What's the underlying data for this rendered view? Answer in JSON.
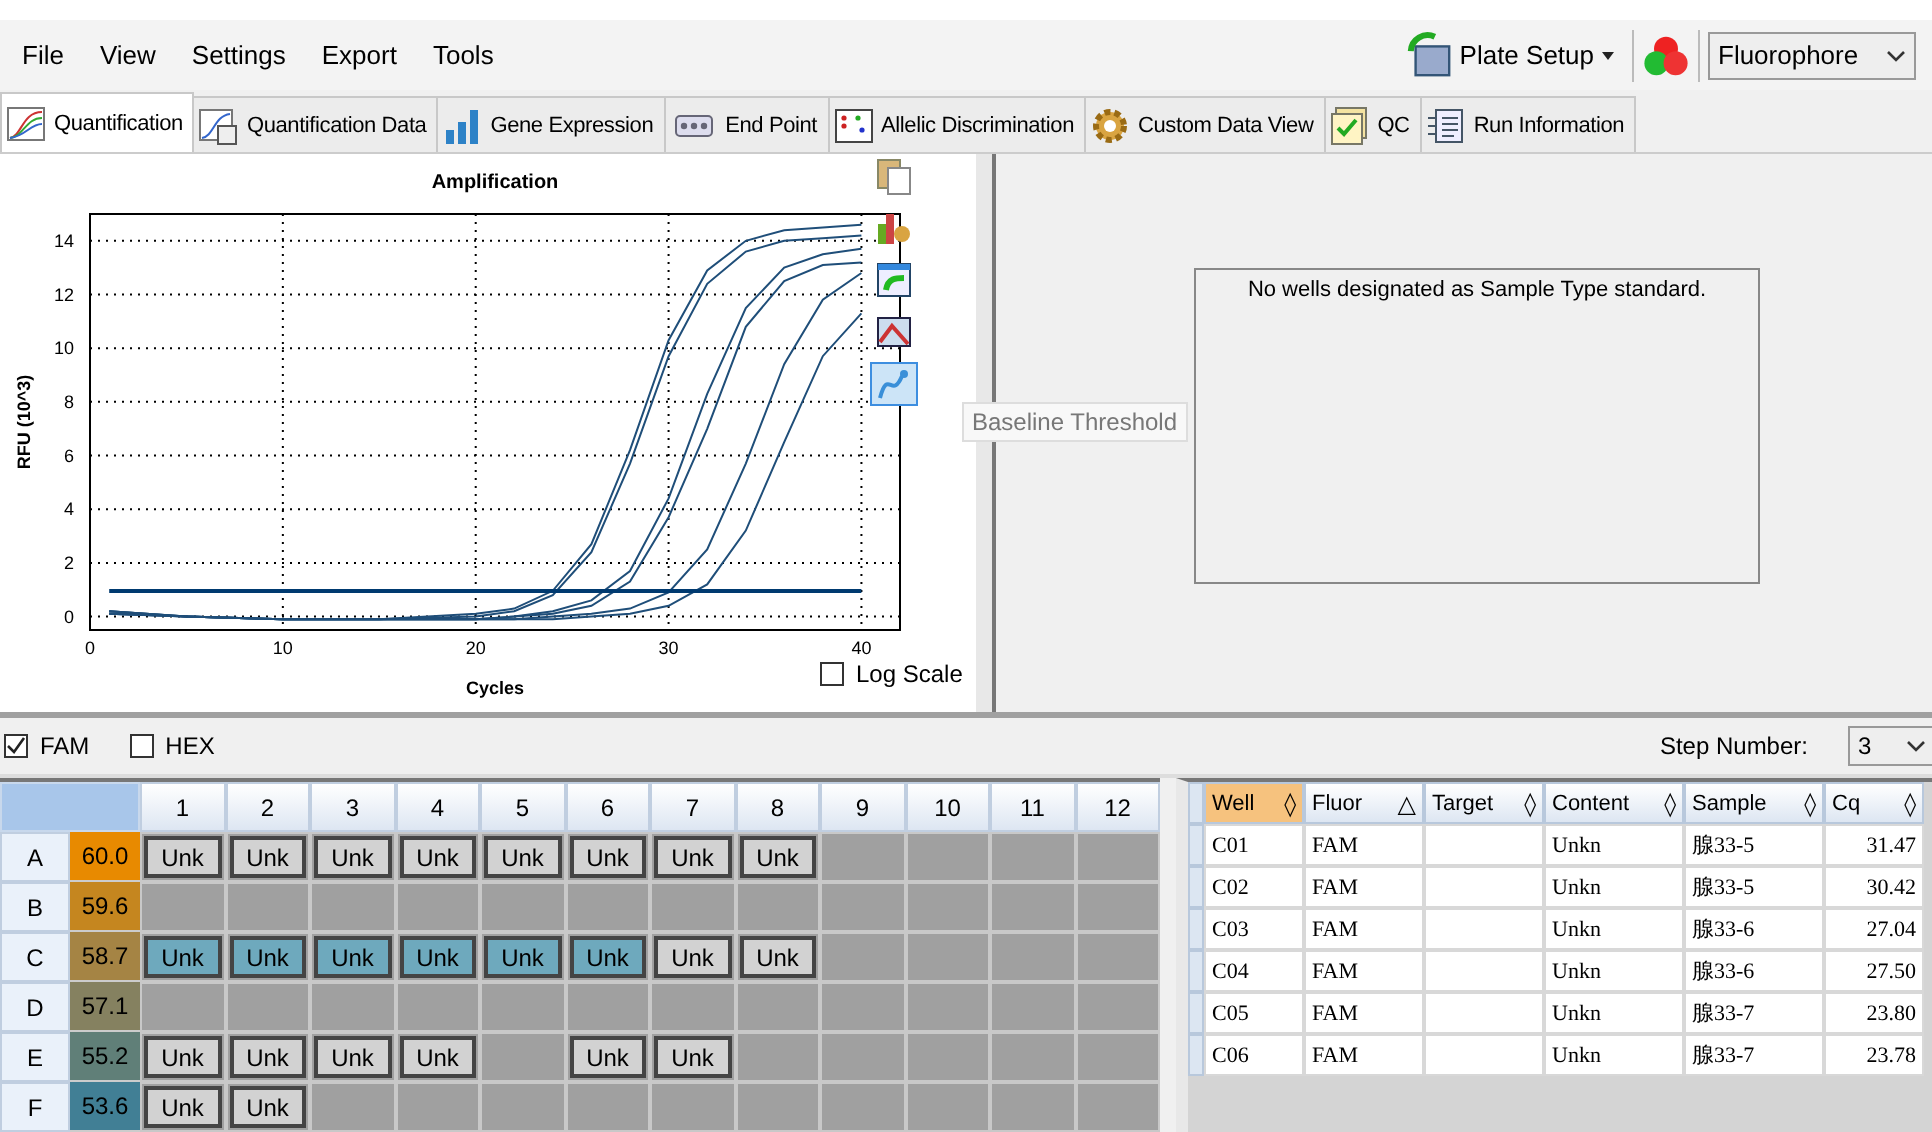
{
  "menu": [
    "File",
    "View",
    "Settings",
    "Export",
    "Tools"
  ],
  "toolbar": {
    "plate_setup": "Plate Setup",
    "fluorophore": "Fluorophore"
  },
  "tabs": [
    {
      "label": "Quantification",
      "selected": true
    },
    {
      "label": "Quantification Data",
      "selected": false
    },
    {
      "label": "Gene Expression",
      "selected": false
    },
    {
      "label": "End Point",
      "selected": false
    },
    {
      "label": "Allelic Discrimination",
      "selected": false
    },
    {
      "label": "Custom Data View",
      "selected": false
    },
    {
      "label": "QC",
      "selected": false
    },
    {
      "label": "Run Information",
      "selected": false
    }
  ],
  "chart_panel": {
    "log_scale": {
      "label": "Log Scale",
      "checked": false
    },
    "side_tools": [
      {
        "kind": "copy",
        "selected": false
      },
      {
        "kind": "settings",
        "selected": false
      },
      {
        "kind": "export",
        "selected": false
      },
      {
        "kind": "zoom",
        "selected": false
      },
      {
        "kind": "baseline",
        "selected": true
      }
    ],
    "tooltip": "Baseline Threshold",
    "chart_data": {
      "type": "line",
      "title": "Amplification",
      "xlabel": "Cycles",
      "ylabel": "RFU (10^3)",
      "grid": true,
      "x": [
        1,
        5,
        10,
        15,
        20,
        22,
        24,
        26,
        28,
        30,
        32,
        34,
        36,
        38,
        40
      ],
      "xlim": [
        0,
        42
      ],
      "ylim": [
        -0.5,
        15
      ],
      "xticks": [
        {
          "value": 0,
          "label": "0"
        },
        {
          "value": 10,
          "label": "10"
        },
        {
          "value": 20,
          "label": "20"
        },
        {
          "value": 30,
          "label": "30"
        },
        {
          "value": 40,
          "label": "40"
        }
      ],
      "yticks": [
        {
          "value": 0,
          "label": "0"
        },
        {
          "value": 2,
          "label": "2"
        },
        {
          "value": 4,
          "label": "4"
        },
        {
          "value": 6,
          "label": "6"
        },
        {
          "value": 8,
          "label": "8"
        },
        {
          "value": 10,
          "label": "10"
        },
        {
          "value": 12,
          "label": "12"
        },
        {
          "value": 14,
          "label": "14"
        }
      ],
      "series": [
        {
          "color": "#1f4e79",
          "values": [
            0.2,
            0,
            -0.1,
            -0.1,
            0.1,
            0.3,
            0.96,
            2.7,
            6.2,
            10.3,
            12.9,
            14.0,
            14.4,
            14.5,
            14.6
          ]
        },
        {
          "color": "#1f4e79",
          "values": [
            0.1,
            0,
            -0.1,
            -0.1,
            0,
            0.2,
            0.8,
            2.4,
            5.7,
            9.7,
            12.4,
            13.6,
            14.0,
            14.1,
            14.2
          ]
        },
        {
          "color": "#1f4e79",
          "values": [
            0.2,
            0,
            -0.1,
            -0.1,
            -0.1,
            0,
            0.2,
            0.6,
            1.7,
            4.4,
            8.3,
            11.5,
            13.0,
            13.5,
            13.7
          ]
        },
        {
          "color": "#1f4e79",
          "values": [
            0.1,
            0,
            -0.1,
            -0.1,
            -0.1,
            0,
            0.1,
            0.4,
            1.3,
            3.7,
            7.0,
            10.8,
            12.5,
            13.1,
            13.2
          ]
        },
        {
          "color": "#1f4e79",
          "values": [
            0.2,
            0,
            -0.1,
            -0.1,
            -0.1,
            -0.1,
            0,
            0.1,
            0.3,
            0.9,
            2.5,
            5.7,
            9.4,
            11.8,
            12.8
          ]
        },
        {
          "color": "#1f4e79",
          "values": [
            0.1,
            0,
            -0.1,
            -0.1,
            -0.1,
            -0.1,
            -0.1,
            0,
            0.1,
            0.4,
            1.2,
            3.2,
            6.5,
            9.7,
            11.3
          ]
        },
        {
          "color": "#003a70",
          "values": [
            0.95,
            0.95,
            0.95,
            0.95,
            0.95,
            0.95,
            0.95,
            0.95,
            0.95,
            0.95,
            0.95,
            0.95,
            0.95,
            0.95,
            0.95
          ]
        }
      ]
    }
  },
  "standard_panel": {
    "message": "No wells designated as Sample Type standard."
  },
  "channels": [
    {
      "label": "FAM",
      "checked": true
    },
    {
      "label": "HEX",
      "checked": false
    }
  ],
  "step_number": {
    "label": "Step Number:",
    "value": "3"
  },
  "plate": {
    "columns": [
      "1",
      "2",
      "3",
      "4",
      "5",
      "6",
      "7",
      "8",
      "9",
      "10",
      "11",
      "12"
    ],
    "rows": [
      {
        "label": "A",
        "temp": "60.0",
        "color": "#e88a00",
        "wells": [
          {
            "content": "Unk",
            "selected": false
          },
          {
            "content": "Unk",
            "selected": false
          },
          {
            "content": "Unk",
            "selected": false
          },
          {
            "content": "Unk",
            "selected": false
          },
          {
            "content": "Unk",
            "selected": false
          },
          {
            "content": "Unk",
            "selected": false
          },
          {
            "content": "Unk",
            "selected": false
          },
          {
            "content": "Unk",
            "selected": false
          },
          {
            "selected": false
          },
          {
            "selected": false
          },
          {
            "selected": false
          },
          {
            "selected": false
          }
        ]
      },
      {
        "label": "B",
        "temp": "59.6",
        "color": "#c5861f",
        "wells": [
          {
            "selected": false
          },
          {
            "selected": false
          },
          {
            "selected": false
          },
          {
            "selected": false
          },
          {
            "selected": false
          },
          {
            "selected": false
          },
          {
            "selected": false
          },
          {
            "selected": false
          },
          {
            "selected": false
          },
          {
            "selected": false
          },
          {
            "selected": false
          },
          {
            "selected": false
          }
        ]
      },
      {
        "label": "C",
        "temp": "58.7",
        "color": "#a58444",
        "wells": [
          {
            "content": "Unk",
            "selected": true
          },
          {
            "content": "Unk",
            "selected": true
          },
          {
            "content": "Unk",
            "selected": true
          },
          {
            "content": "Unk",
            "selected": true
          },
          {
            "content": "Unk",
            "selected": true
          },
          {
            "content": "Unk",
            "selected": true
          },
          {
            "content": "Unk",
            "selected": false
          },
          {
            "content": "Unk",
            "selected": false
          },
          {
            "selected": false
          },
          {
            "selected": false
          },
          {
            "selected": false
          },
          {
            "selected": false
          }
        ]
      },
      {
        "label": "D",
        "temp": "57.1",
        "color": "#858160",
        "wells": [
          {
            "selected": false
          },
          {
            "selected": false
          },
          {
            "selected": false
          },
          {
            "selected": false
          },
          {
            "selected": false
          },
          {
            "selected": false
          },
          {
            "selected": false
          },
          {
            "selected": false
          },
          {
            "selected": false
          },
          {
            "selected": false
          },
          {
            "selected": false
          },
          {
            "selected": false
          }
        ]
      },
      {
        "label": "E",
        "temp": "55.2",
        "color": "#607f78",
        "wells": [
          {
            "content": "Unk",
            "selected": false
          },
          {
            "content": "Unk",
            "selected": false
          },
          {
            "content": "Unk",
            "selected": false
          },
          {
            "content": "Unk",
            "selected": false
          },
          {
            "selected": false
          },
          {
            "content": "Unk",
            "selected": false
          },
          {
            "content": "Unk",
            "selected": false
          },
          {
            "selected": false
          },
          {
            "selected": false
          },
          {
            "selected": false
          },
          {
            "selected": false
          },
          {
            "selected": false
          }
        ]
      },
      {
        "label": "F",
        "temp": "53.6",
        "color": "#417f95",
        "wells": [
          {
            "content": "Unk",
            "selected": false
          },
          {
            "content": "Unk",
            "selected": false
          },
          {
            "selected": false
          },
          {
            "selected": false
          },
          {
            "selected": false
          },
          {
            "selected": false
          },
          {
            "selected": false
          },
          {
            "selected": false
          },
          {
            "selected": false
          },
          {
            "selected": false
          },
          {
            "selected": false
          },
          {
            "selected": false
          }
        ]
      }
    ]
  },
  "results": {
    "columns": [
      {
        "label": "Well",
        "selected": true,
        "sort_mark": "◊"
      },
      {
        "label": "Fluor",
        "selected": false,
        "sort_mark": "△"
      },
      {
        "label": "Target",
        "selected": false,
        "sort_mark": "◊"
      },
      {
        "label": "Content",
        "selected": false,
        "sort_mark": "◊"
      },
      {
        "label": "Sample",
        "selected": false,
        "sort_mark": "◊"
      },
      {
        "label": "Cq",
        "selected": false,
        "sort_mark": "◊"
      }
    ],
    "rows": [
      {
        "well": "C01",
        "fluor": "FAM",
        "content": "Unkn",
        "sample": "腺33-5",
        "cq": "31.47"
      },
      {
        "well": "C02",
        "fluor": "FAM",
        "content": "Unkn",
        "sample": "腺33-5",
        "cq": "30.42"
      },
      {
        "well": "C03",
        "fluor": "FAM",
        "content": "Unkn",
        "sample": "腺33-6",
        "cq": "27.04"
      },
      {
        "well": "C04",
        "fluor": "FAM",
        "content": "Unkn",
        "sample": "腺33-6",
        "cq": "27.50"
      },
      {
        "well": "C05",
        "fluor": "FAM",
        "content": "Unkn",
        "sample": "腺33-7",
        "cq": "23.80"
      },
      {
        "well": "C06",
        "fluor": "FAM",
        "content": "Unkn",
        "sample": "腺33-7",
        "cq": "23.78"
      }
    ]
  }
}
